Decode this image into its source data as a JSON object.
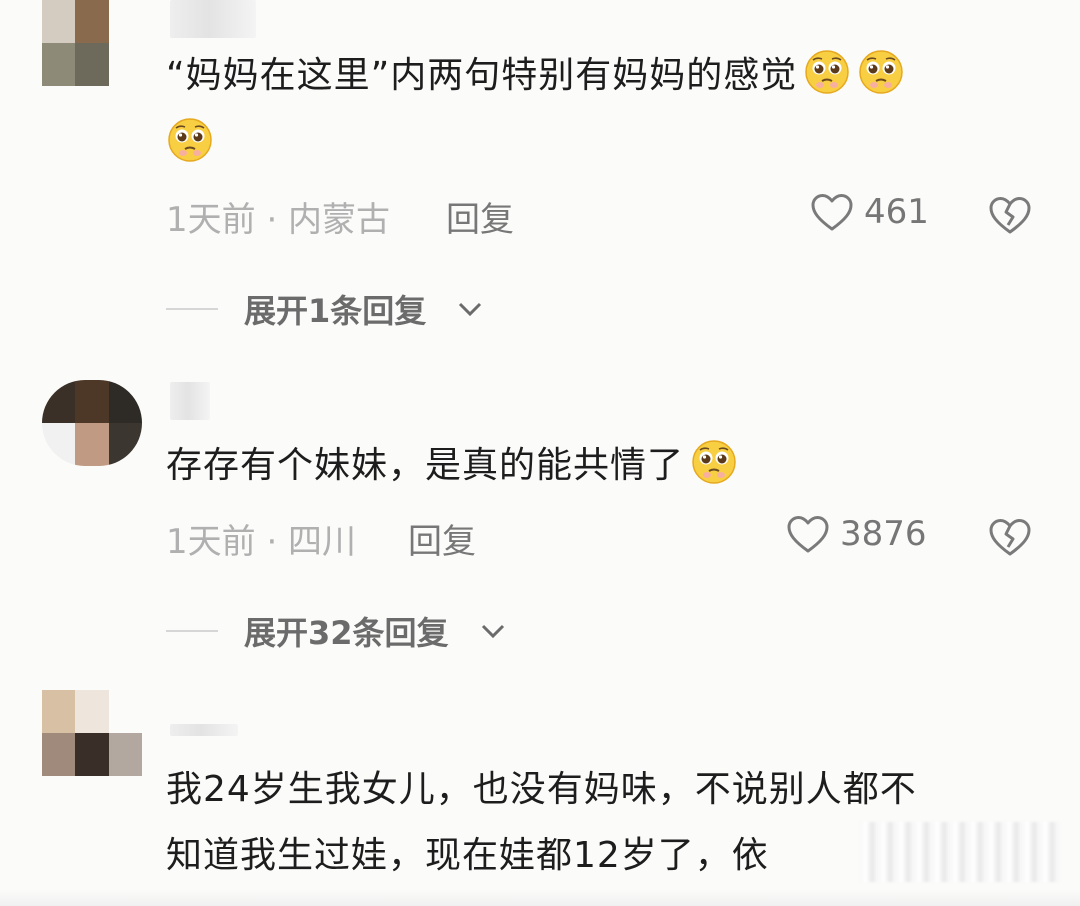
{
  "comments": [
    {
      "text_line1": "“妈妈在这里”内两句特别有妈妈的感觉",
      "time_location": "1天前 · 内蒙古",
      "reply_label": "回复",
      "likes": "461",
      "expand_label": "展开1条回复"
    },
    {
      "text_line1": "存存有个妹妹，是真的能共情了",
      "time_location": "1天前 · 四川",
      "reply_label": "回复",
      "likes": "3876",
      "expand_label": "展开32条回复"
    },
    {
      "text_line1": "我24岁生我女儿，也没有妈味，不说别人都不",
      "text_line2": "知道我生过娃，现在娃都12岁了，依"
    }
  ],
  "icons": {
    "like": "heart-outline-icon",
    "dislike": "broken-heart-icon",
    "expand": "chevron-down-icon",
    "emoji": "pleading-face-emoji"
  },
  "colors": {
    "background": "#fbfbfa",
    "text": "#1d1d1d",
    "meta": "#b0b0b0",
    "muted": "#767676"
  }
}
